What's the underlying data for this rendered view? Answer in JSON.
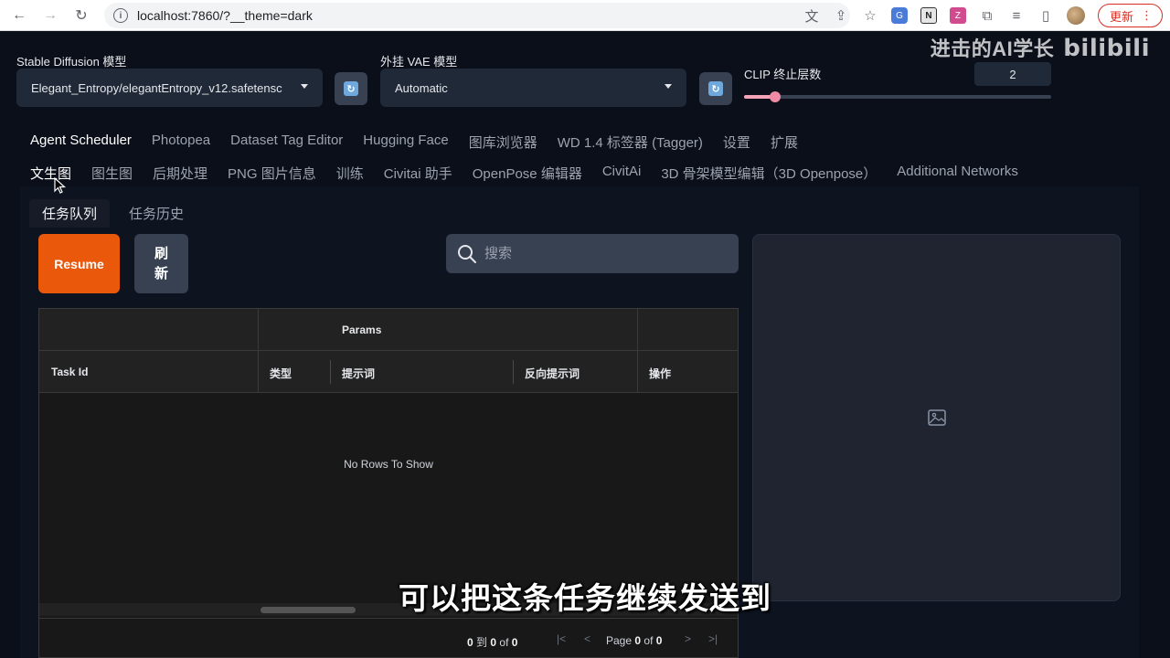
{
  "browser": {
    "url": "localhost:7860/?__theme=dark",
    "update_label": "更新"
  },
  "watermark": {
    "text": "进击的AI学长",
    "logo": "bilibili"
  },
  "top": {
    "sd_model_label": "Stable Diffusion 模型",
    "sd_model_value": "Elegant_Entropy/elegantEntropy_v12.safetensc",
    "vae_label": "外挂 VAE 模型",
    "vae_value": "Automatic",
    "clip_label": "CLIP 终止层数",
    "clip_value": "2",
    "clip_slider_fraction": 0.1
  },
  "tabs_row1": [
    "Agent Scheduler",
    "Photopea",
    "Dataset Tag Editor",
    "Hugging Face",
    "图库浏览器",
    "WD 1.4 标签器 (Tagger)",
    "设置",
    "扩展"
  ],
  "tabs_row2": [
    "文生图",
    "图生图",
    "后期处理",
    "PNG 图片信息",
    "训练",
    "Civitai 助手",
    "OpenPose 编辑器",
    "CivitAi",
    "3D 骨架模型编辑（3D Openpose）",
    "Additional Networks"
  ],
  "subtabs": [
    "任务队列",
    "任务历史"
  ],
  "actions": {
    "resume_label": "Resume",
    "refresh_label": "刷新"
  },
  "search": {
    "placeholder": "搜索"
  },
  "grid": {
    "group_header": "Params",
    "columns": [
      "Task Id",
      "类型",
      "提示词",
      "反向提示词",
      "操作"
    ],
    "empty_text": "No Rows To Show",
    "footer": {
      "from": "0",
      "to_word": "到",
      "to": "0",
      "of_word": "of",
      "total": "0",
      "page_word": "Page",
      "page": "0",
      "page_total": "0"
    }
  },
  "subtitle": "可以把这条任务继续发送到"
}
